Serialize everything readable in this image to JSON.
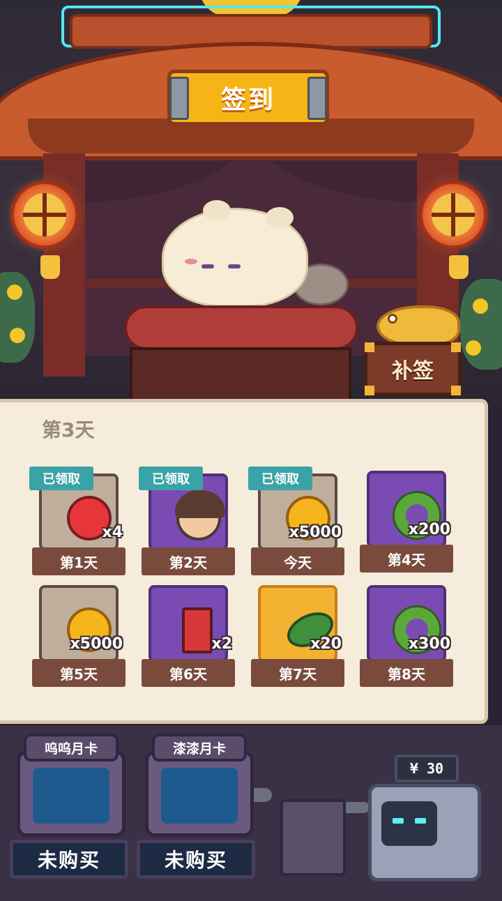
{
  "header": {
    "sign_text": "签到"
  },
  "scene": {
    "makeup_button_label": "补签"
  },
  "panel": {
    "title": "第3天",
    "claimed_label": "已领取",
    "days": [
      {
        "label": "第1天",
        "qty": "x4",
        "claimed": true,
        "item_icon": "red-potion-icon",
        "card_color": "tan"
      },
      {
        "label": "第2天",
        "qty": "",
        "claimed": true,
        "item_icon": "character-avatar-icon",
        "card_color": "purple"
      },
      {
        "label": "今天",
        "qty": "x5000",
        "claimed": true,
        "item_icon": "gold-coin-icon",
        "card_color": "tan"
      },
      {
        "label": "第4天",
        "qty": "x200",
        "claimed": false,
        "item_icon": "green-ring-icon",
        "card_color": "purple"
      },
      {
        "label": "第5天",
        "qty": "x5000",
        "claimed": false,
        "item_icon": "gold-coin-icon",
        "card_color": "tan"
      },
      {
        "label": "第6天",
        "qty": "x2",
        "claimed": false,
        "item_icon": "battery-icon",
        "card_color": "purple"
      },
      {
        "label": "第7天",
        "qty": "x20",
        "claimed": false,
        "item_icon": "cucumber-icon",
        "card_color": "orange"
      },
      {
        "label": "第8天",
        "qty": "x300",
        "claimed": false,
        "item_icon": "green-ring-icon",
        "card_color": "purple"
      }
    ]
  },
  "monthly_cards": [
    {
      "name": "呜呜月卡",
      "status": "未购买"
    },
    {
      "name": "漆漆月卡",
      "status": "未购买"
    }
  ],
  "shop": {
    "price": "¥ 30"
  },
  "colors": {
    "claimed_badge": "#3aa3a7",
    "day_label_bg": "#7a4b3d",
    "panel_bg": "#f5ecdc"
  }
}
